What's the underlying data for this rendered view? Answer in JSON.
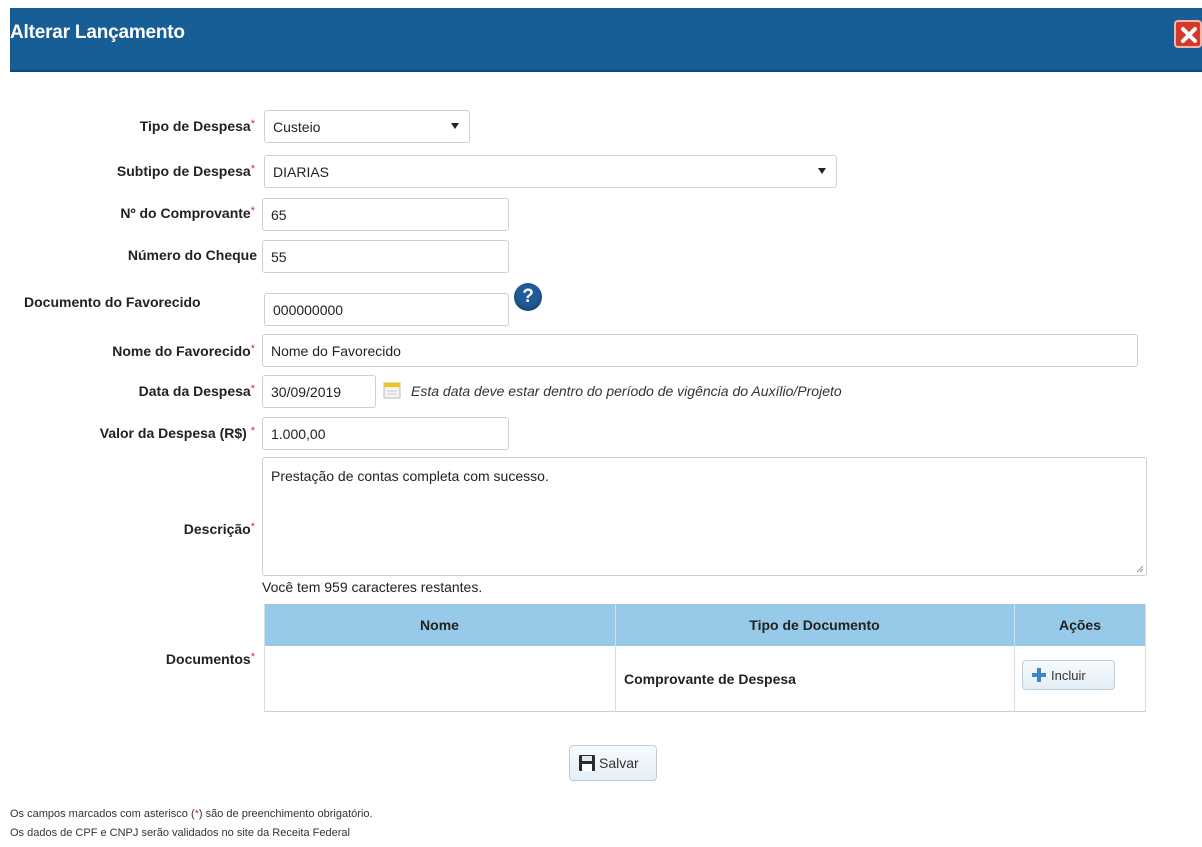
{
  "dialog": {
    "title": "Alterar Lançamento",
    "close_icon": "close-icon"
  },
  "form": {
    "tipo_despesa": {
      "label": "Tipo de Despesa",
      "required": "*",
      "value": "Custeio"
    },
    "subtipo_despesa": {
      "label": "Subtipo de Despesa",
      "required": "*",
      "value": "DIARIAS"
    },
    "comprovante": {
      "label": "Nº do Comprovante",
      "required": "*",
      "value": "65"
    },
    "cheque": {
      "label": "Número do Cheque",
      "value": "55"
    },
    "documento_favorecido": {
      "label": "Documento do Favorecido",
      "value": "000000000",
      "help_icon": "question-icon"
    },
    "nome_favorecido": {
      "label": "Nome do Favorecido",
      "required": "*",
      "value": "Nome do Favorecido"
    },
    "data_despesa": {
      "label": "Data da Despesa",
      "required": "*",
      "value": "30/09/2019",
      "hint": "Esta data deve estar dentro do período de vigência do Auxílio/Projeto"
    },
    "valor_despesa": {
      "label": "Valor da Despesa (R$)",
      "required": "*",
      "value": "1.000,00"
    },
    "descricao": {
      "label": "Descrição",
      "required": "*",
      "value": "Prestação de contas completa com sucesso.",
      "counter": "Você tem 959 caracteres restantes."
    },
    "documentos": {
      "label": "Documentos",
      "required": "*",
      "columns": [
        "Nome",
        "Tipo de Documento",
        "Ações"
      ],
      "rows": [
        {
          "nome": "",
          "tipo": "Comprovante de Despesa",
          "action": "Incluir"
        }
      ]
    }
  },
  "actions": {
    "save": "Salvar"
  },
  "footer": {
    "line1_a": "Os campos marcados com asterisco (",
    "line1_star": "*",
    "line1_b": ") são de preenchimento obrigatório.",
    "line2": "Os dados de CPF e CNPJ serão validados no site da Receita Federal"
  },
  "colors": {
    "header": "#175d96",
    "table_header": "#97c9e8",
    "required": "#c0392b"
  }
}
